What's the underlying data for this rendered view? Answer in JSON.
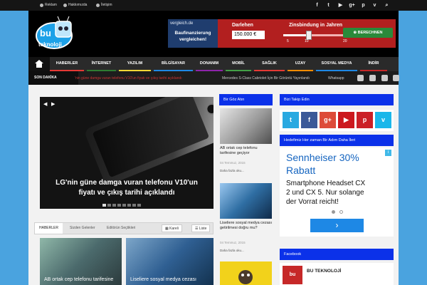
{
  "topbar": {
    "links": [
      {
        "label": "Reklam",
        "icon": "megaphone-icon"
      },
      {
        "label": "Hakkımızda",
        "icon": "info-icon"
      },
      {
        "label": "İletişim",
        "icon": "phone-icon"
      }
    ],
    "social": [
      "facebook-icon",
      "twitter-icon",
      "youtube-icon",
      "googleplus-icon",
      "pinterest-icon",
      "vimeo-icon",
      "search-icon"
    ]
  },
  "header": {
    "logo_text": "bu teknoloji",
    "ad": {
      "brand": "vergleich.de",
      "left_line1": "Baufinanzierung",
      "left_line2": "vergleichen!",
      "loan_label": "Darlehen",
      "loan_value": "150.000 €",
      "term_label": "Zinsbindung in Jahren",
      "term_value": 0.4,
      "tick_min": "5",
      "tick_mid": "10",
      "tick_max": "20",
      "button_label": "BERECHNEN"
    }
  },
  "nav": {
    "items": [
      {
        "label": "HABERLER",
        "color": "#e53935"
      },
      {
        "label": "İNTERNET",
        "color": "#2e7d32"
      },
      {
        "label": "YAZILIM",
        "color": "#fdd835"
      },
      {
        "label": "BİLGİSAYAR",
        "color": "#1e88e5"
      },
      {
        "label": "DONANIM",
        "color": "#8e24aa"
      },
      {
        "label": "MOBİL",
        "color": "#43a047"
      },
      {
        "label": "SAĞLIK",
        "color": "#e53935"
      },
      {
        "label": "UZAY",
        "color": "#fb8c00"
      },
      {
        "label": "SOSYAL MEDYA",
        "color": "#1e88e5"
      },
      {
        "label": "İNDİR",
        "color": "#c62828"
      }
    ]
  },
  "ticker": {
    "label": "SON DAKİKA",
    "items": [
      "'nin güne damga vuran telefonu V10'un fiyatı ve çıkış tarihi açıklandı",
      "Mercedes S-Class Cabriolet İçin Bir Görüntü Yayınlandı",
      "Whatsapp"
    ]
  },
  "slider": {
    "title_line1": "LG'nin güne damga vuran telefonu V10'un",
    "title_line2": "fiyatı ve çıkış tarihi açıklandı",
    "dot_count": 8
  },
  "tabs": {
    "items": [
      "HABERLER",
      "Sizden Gelenler",
      "Editörün Seçtikleri"
    ],
    "views": [
      "Kareli",
      "Liste"
    ]
  },
  "grid_posts": [
    {
      "title": "AB ortak cep telefonu tarifesine"
    },
    {
      "title": "Liseliere sosyal medya cezası"
    }
  ],
  "middle": {
    "heading": "Bir Göz Atın",
    "posts": [
      {
        "title": "AB ortak cep telefonu tarifesine geçiyor",
        "date": "04 Temmuz, 2015",
        "more": "Daha fazla oku..."
      },
      {
        "title": "Liseliere sosyal medya cezası getirilmesi doğru mu?",
        "date": "04 Temmuz, 2015",
        "more": "Daha fazla oku..."
      }
    ]
  },
  "sidebar": {
    "follow_heading": "Bizi Takip Edin",
    "social_buttons": [
      {
        "icon": "twitter-icon",
        "glyph": "t",
        "color": "#29a9e1"
      },
      {
        "icon": "facebook-icon",
        "glyph": "f",
        "color": "#3b5998"
      },
      {
        "icon": "googleplus-icon",
        "glyph": "g+",
        "color": "#dd4b39"
      },
      {
        "icon": "youtube-icon",
        "glyph": "▶",
        "color": "#cc181e"
      },
      {
        "icon": "pinterest-icon",
        "glyph": "p",
        "color": "#cb2027"
      },
      {
        "icon": "vimeo-icon",
        "glyph": "v",
        "color": "#1ab7ea"
      }
    ],
    "slogan": "Hedefimiz Her zaman Bir Adım Daha İleri",
    "ad": {
      "line1": "Sennheiser 30%",
      "line2": "Rabatt",
      "body1": "Smartphone Headset CX",
      "body2": "2 und CX 5. Nur solange",
      "body3": "der Vorrat reicht!",
      "button": "›"
    },
    "facebook_heading": "Facebook",
    "facebook_page": "BU TEKNOLOJİ"
  }
}
